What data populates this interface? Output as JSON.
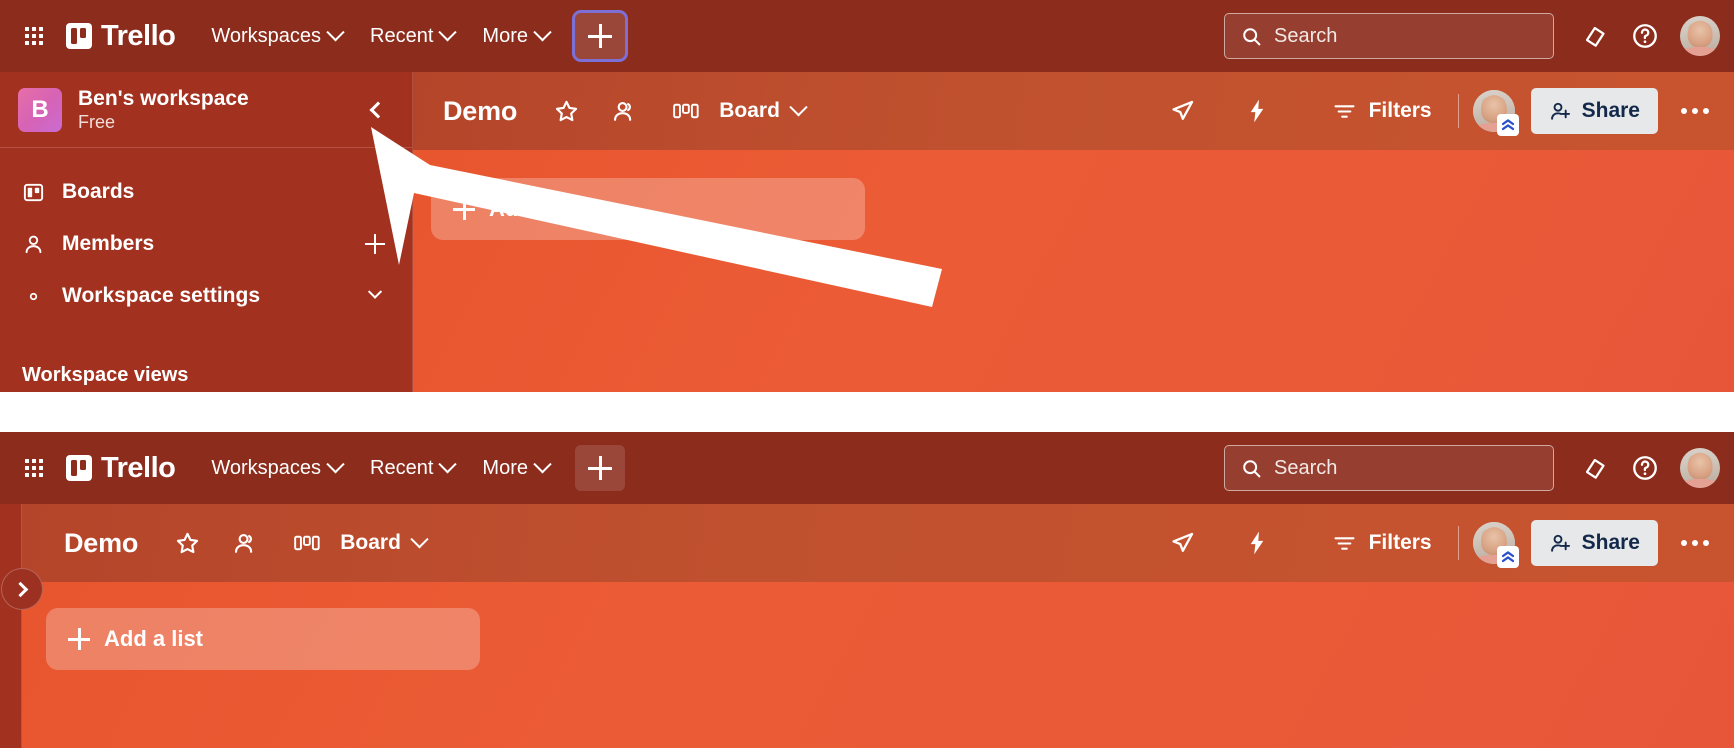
{
  "app": {
    "brand": "Trello",
    "apps_icon": "apps-grid-icon",
    "logo_icon": "trello-logo-icon"
  },
  "topnav": {
    "items": [
      {
        "label": "Workspaces",
        "icon": "chevron-down-icon"
      },
      {
        "label": "Recent",
        "icon": "chevron-down-icon"
      },
      {
        "label": "More",
        "icon": "chevron-down-icon"
      }
    ],
    "create_button_label": "+",
    "create_button_icon": "plus-icon",
    "search": {
      "placeholder": "Search",
      "icon": "search-icon"
    },
    "notifications_icon": "notification-bell-icon",
    "help_icon": "help-question-icon",
    "account_avatar": "user-avatar"
  },
  "sidebar": {
    "workspace_initial": "B",
    "workspace_name": "Ben's workspace",
    "workspace_plan": "Free",
    "collapse_icon": "chevron-left-icon",
    "items": [
      {
        "label": "Boards",
        "icon": "board-icon",
        "tail": "none"
      },
      {
        "label": "Members",
        "icon": "member-person-icon",
        "tail": "plus-icon"
      },
      {
        "label": "Workspace settings",
        "icon": "gear-icon",
        "tail": "chevron-down-icon"
      }
    ],
    "section_title": "Workspace views"
  },
  "board_header": {
    "title": "Demo",
    "star_icon": "star-outline-icon",
    "visibility_icon": "workspace-visible-icon",
    "view_icon": "board-columns-icon",
    "view_label": "Board",
    "view_chevron": "chevron-down-icon",
    "rocket_icon": "rocket-paper-plane-icon",
    "power_ups_icon": "lightning-bolt-icon",
    "filters_label": "Filters",
    "filters_icon": "filter-funnel-icon",
    "member_avatar": "board-member-avatar",
    "member_badge_icon": "premium-upgrade-chevrons-icon",
    "share_label": "Share",
    "share_icon": "person-add-icon",
    "more_icon": "ellipsis-horizontal-icon"
  },
  "board_canvas": {
    "add_list_label": "Add a list",
    "add_list_icon": "plus-icon"
  },
  "panel_two": {
    "expand_sidebar_icon": "chevron-right-icon"
  },
  "annotation": {
    "arrow_icon": "pointer-arrow-annotation",
    "color": "#ffffff",
    "points_to": "sidebar-collapse-button"
  },
  "colors": {
    "topnav_bg": "#8c2c1c",
    "sidebar_bg": "#a3311f",
    "board_header_bg": "#c0512f",
    "canvas_bg": "#e8562f",
    "share_bg": "#e6e8ea",
    "share_text": "#14284a",
    "workspace_logo": "#d763b4",
    "focus_outline": "#7c6fd6"
  }
}
